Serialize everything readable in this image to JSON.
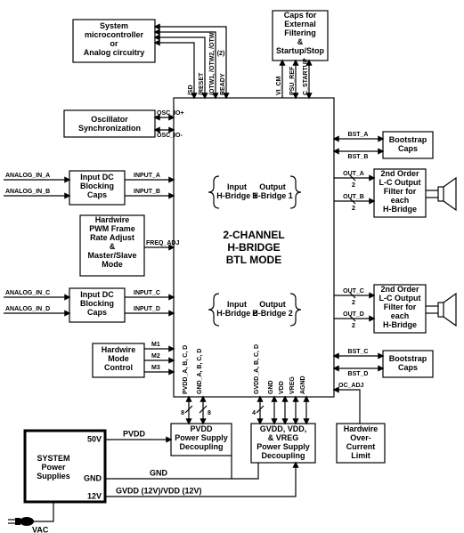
{
  "title1": "2-CHANNEL",
  "title2": "H-BRIDGE",
  "title3": "BTL  MODE",
  "hb_in1": "Input\nH-Bridge 1",
  "hb_out1": "Output\nH-Bridge 1",
  "hb_in2": "Input\nH-Bridge 2",
  "hb_out2": "Output\nH-Bridge 2",
  "ext": {
    "sys_uc": "System\nmicrocontroller\nor\nAnalog circuitry",
    "caps_ext": "Caps for\nExternal\nFiltering\n&\nStartup/Stop",
    "osc_sync": "Oscillator\nSynchronization",
    "dc_block1": "Input DC\nBlocking\nCaps",
    "pwm_frame": "Hardwire\nPWM Frame\nRate Adjust\n&\nMaster/Slave\nMode",
    "dc_block2": "Input DC\nBlocking\nCaps",
    "mode_ctrl": "Hardwire\nMode\nControl",
    "psu": "SYSTEM\nPower\nSupplies",
    "pvdd": "PVDD\nPower Supply\nDecoupling",
    "gvdd": "GVDD, VDD,\n& VREG\nPower Supply\nDecoupling",
    "oc_limit": "Hardwire\nOver-\nCurrent\nLimit",
    "boot1": "Bootstrap\nCaps",
    "boot2": "Bootstrap\nCaps",
    "lc1": "2nd Order\nL-C Output\nFilter for\neach\nH-Bridge",
    "lc2": "2nd Order\nL-C Output\nFilter for\neach\nH-Bridge"
  },
  "signals": {
    "osc_p": "OSC_IO+",
    "osc_n": "OSC_IO-",
    "in_a": "INPUT_A",
    "in_b": "INPUT_B",
    "in_c": "INPUT_C",
    "in_d": "INPUT_D",
    "freq": "FREQ_ADJ",
    "m1": "M1",
    "m2": "M2",
    "m3": "M3",
    "ain_a": "ANALOG_IN_A",
    "ain_b": "ANALOG_IN_B",
    "ain_c": "ANALOG_IN_C",
    "ain_d": "ANALOG_IN_D",
    "out_a": "OUT_A",
    "out_b": "OUT_B",
    "out_c": "OUT_C",
    "out_d": "OUT_D",
    "bst_a": "BST_A",
    "bst_b": "BST_B",
    "bst_c": "BST_C",
    "bst_d": "BST_D",
    "oc_adj": "OC_ADJ",
    "pvdd_l": "PVDD_A, B, C, D",
    "gnd_l": "GND_A, B, C, D",
    "gvdd_l": "GVDD_A, B, C, D",
    "gnd": "GND",
    "vdd": "VDD",
    "vreg": "VREG",
    "agnd": "AGND",
    "top_sd": "/SD",
    "top_reset": "/RESET",
    "top_otw": "/OTW1, /OTW2, /OTW",
    "top_ready": "READY",
    "top_vicm": "VI_CM",
    "top_psu": "PSU_REF",
    "top_cstart": "C_STARTUP",
    "bus2": "(2)",
    "bus8a": "8",
    "bus8b": "8",
    "bus4": "4",
    "outbus2": "2",
    "psu_50": "50V",
    "psu_gnd": "GND",
    "psu_12": "12V",
    "pvdd_rail": "PVDD",
    "gnd_rail": "GND",
    "gvdd_rail": "GVDD (12V)/VDD (12V)",
    "vac": "VAC",
    "nd": "nd"
  }
}
